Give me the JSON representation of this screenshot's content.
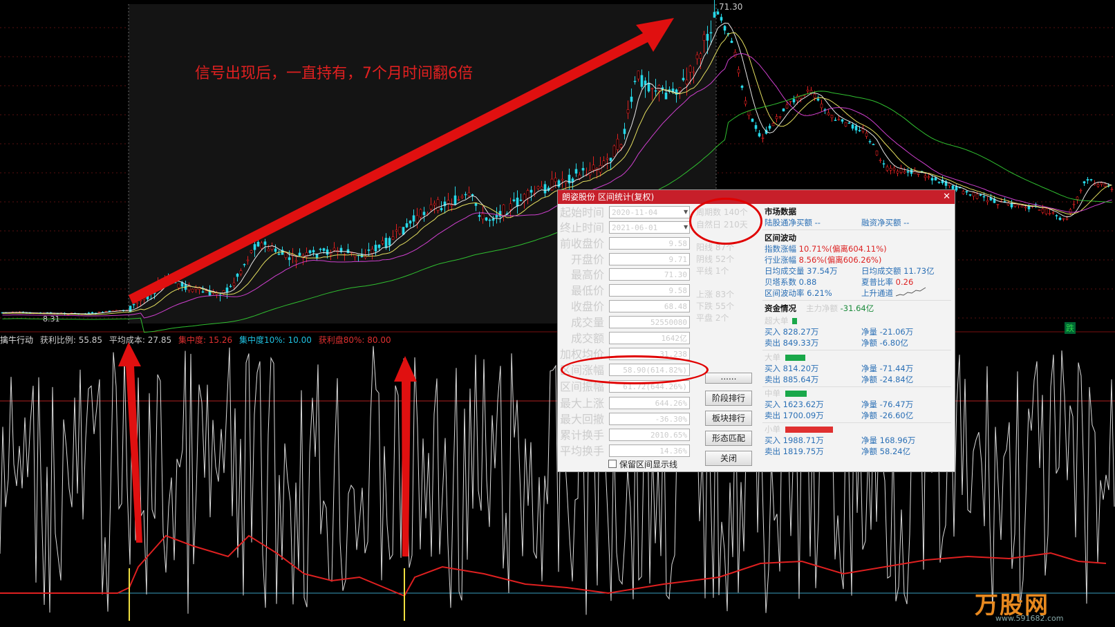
{
  "headline": "信号出现后，一直持有，7个月时间翻6倍",
  "price_chart": {
    "peak_label": "71.30",
    "low_label": "8.31",
    "die_badge": "跌"
  },
  "indicator": {
    "name": "擒牛行动",
    "items": [
      {
        "text": "获利比例: 55.85",
        "color": "#cccccc"
      },
      {
        "text": "平均成本: 27.85",
        "color": "#cccccc"
      },
      {
        "text": "集中度: 15.26",
        "color": "#e03030"
      },
      {
        "text": "集中度10%: 10.00",
        "color": "#20c0e0"
      },
      {
        "text": "获利盘80%: 80.00",
        "color": "#e03030"
      }
    ]
  },
  "dialog": {
    "title": "朗姿股份 区间统计(复权)",
    "fields": [
      {
        "label": "起始时间",
        "value": "2020-11-04"
      },
      {
        "label": "终止时间",
        "value": "2021-06-01"
      },
      {
        "label": "前收盘价",
        "value": "9.58"
      },
      {
        "label": "开盘价",
        "value": "9.71"
      },
      {
        "label": "最高价",
        "value": "71.30"
      },
      {
        "label": "最低价",
        "value": "9.58"
      },
      {
        "label": "收盘价",
        "value": "68.48"
      },
      {
        "label": "成交量",
        "value": "52550080"
      },
      {
        "label": "成交额",
        "value": "1642亿"
      },
      {
        "label": "加权均价",
        "value": "31.238"
      },
      {
        "label": "区间涨幅",
        "value": "58.90(614.82%)"
      },
      {
        "label": "区间振幅",
        "value": "61.72(644.26%)"
      },
      {
        "label": "最大上涨",
        "value": "644.26%"
      },
      {
        "label": "最大回撤",
        "value": "-36.30%"
      },
      {
        "label": "累计换手",
        "value": "2010.65%"
      },
      {
        "label": "平均换手",
        "value": "14.36%"
      }
    ],
    "checkbox_label": "保留区间显示线",
    "mid": {
      "period": "周期数 140个",
      "natural": "自然日 210天",
      "yang": "阳线 87个",
      "yin": "阴线 52个",
      "flat": "平线 1个",
      "up": "上涨 83个",
      "down": "下跌 55个",
      "even": "平盘 2个"
    },
    "buttons": {
      "more": "......",
      "stage": "阶段排行",
      "sector": "板块排行",
      "pattern": "形态匹配",
      "close": "关闭"
    },
    "market": {
      "title": "市场数据",
      "north_buy": "陆股通净买额 --",
      "margin_buy": "融资净买额 --"
    },
    "volatility": {
      "title": "区间波动",
      "index_label": "指数涨幅",
      "index_val": "10.71%",
      "index_dev": "(偏离604.11%)",
      "industry_label": "行业涨幅",
      "industry_val": "8.56%",
      "industry_dev": "(偏离606.26%)",
      "avg_vol_label": "日均成交量",
      "avg_vol_val": "37.54万",
      "avg_amt_label": "日均成交额",
      "avg_amt_val": "11.73亿",
      "beta_label": "贝塔系数",
      "beta_val": "0.88",
      "sharpe_label": "夏普比率",
      "sharpe_val": "0.26",
      "vol_rate_label": "区间波动率",
      "vol_rate_val": "6.21%",
      "channel_label": "上升通道"
    },
    "funds": {
      "title": "资金情况",
      "main_label": "主力净额",
      "main_val": "-31.64亿",
      "groups": [
        {
          "name": "超大单",
          "buy": "买入 828.27万",
          "sell": "卖出 849.33万",
          "net_vol": "净量 -21.06万",
          "net_amt": "净额 -6.80亿",
          "bar": 0.08,
          "bar_color": "#1aa84a"
        },
        {
          "name": "大单",
          "buy": "买入 814.20万",
          "sell": "卖出 885.64万",
          "net_vol": "净量 -71.44万",
          "net_amt": "净额 -24.84亿",
          "bar": 0.32,
          "bar_color": "#1aa84a"
        },
        {
          "name": "中单",
          "buy": "买入 1623.62万",
          "sell": "卖出 1700.09万",
          "net_vol": "净量 -76.47万",
          "net_amt": "净额 -26.60亿",
          "bar": 0.34,
          "bar_color": "#1aa84a"
        },
        {
          "name": "小单",
          "buy": "买入 1988.71万",
          "sell": "卖出 1819.75万",
          "net_vol": "净量 168.96万",
          "net_amt": "净额 58.24亿",
          "bar": 0.75,
          "bar_color": "#e03030"
        }
      ]
    }
  },
  "watermark": {
    "brand": "万股网",
    "url": "www.591682.com"
  },
  "colors": {
    "up": "#e02020",
    "down": "#27d8e8",
    "dialog_title": "#c71f2a",
    "arrow": "#e01010"
  }
}
